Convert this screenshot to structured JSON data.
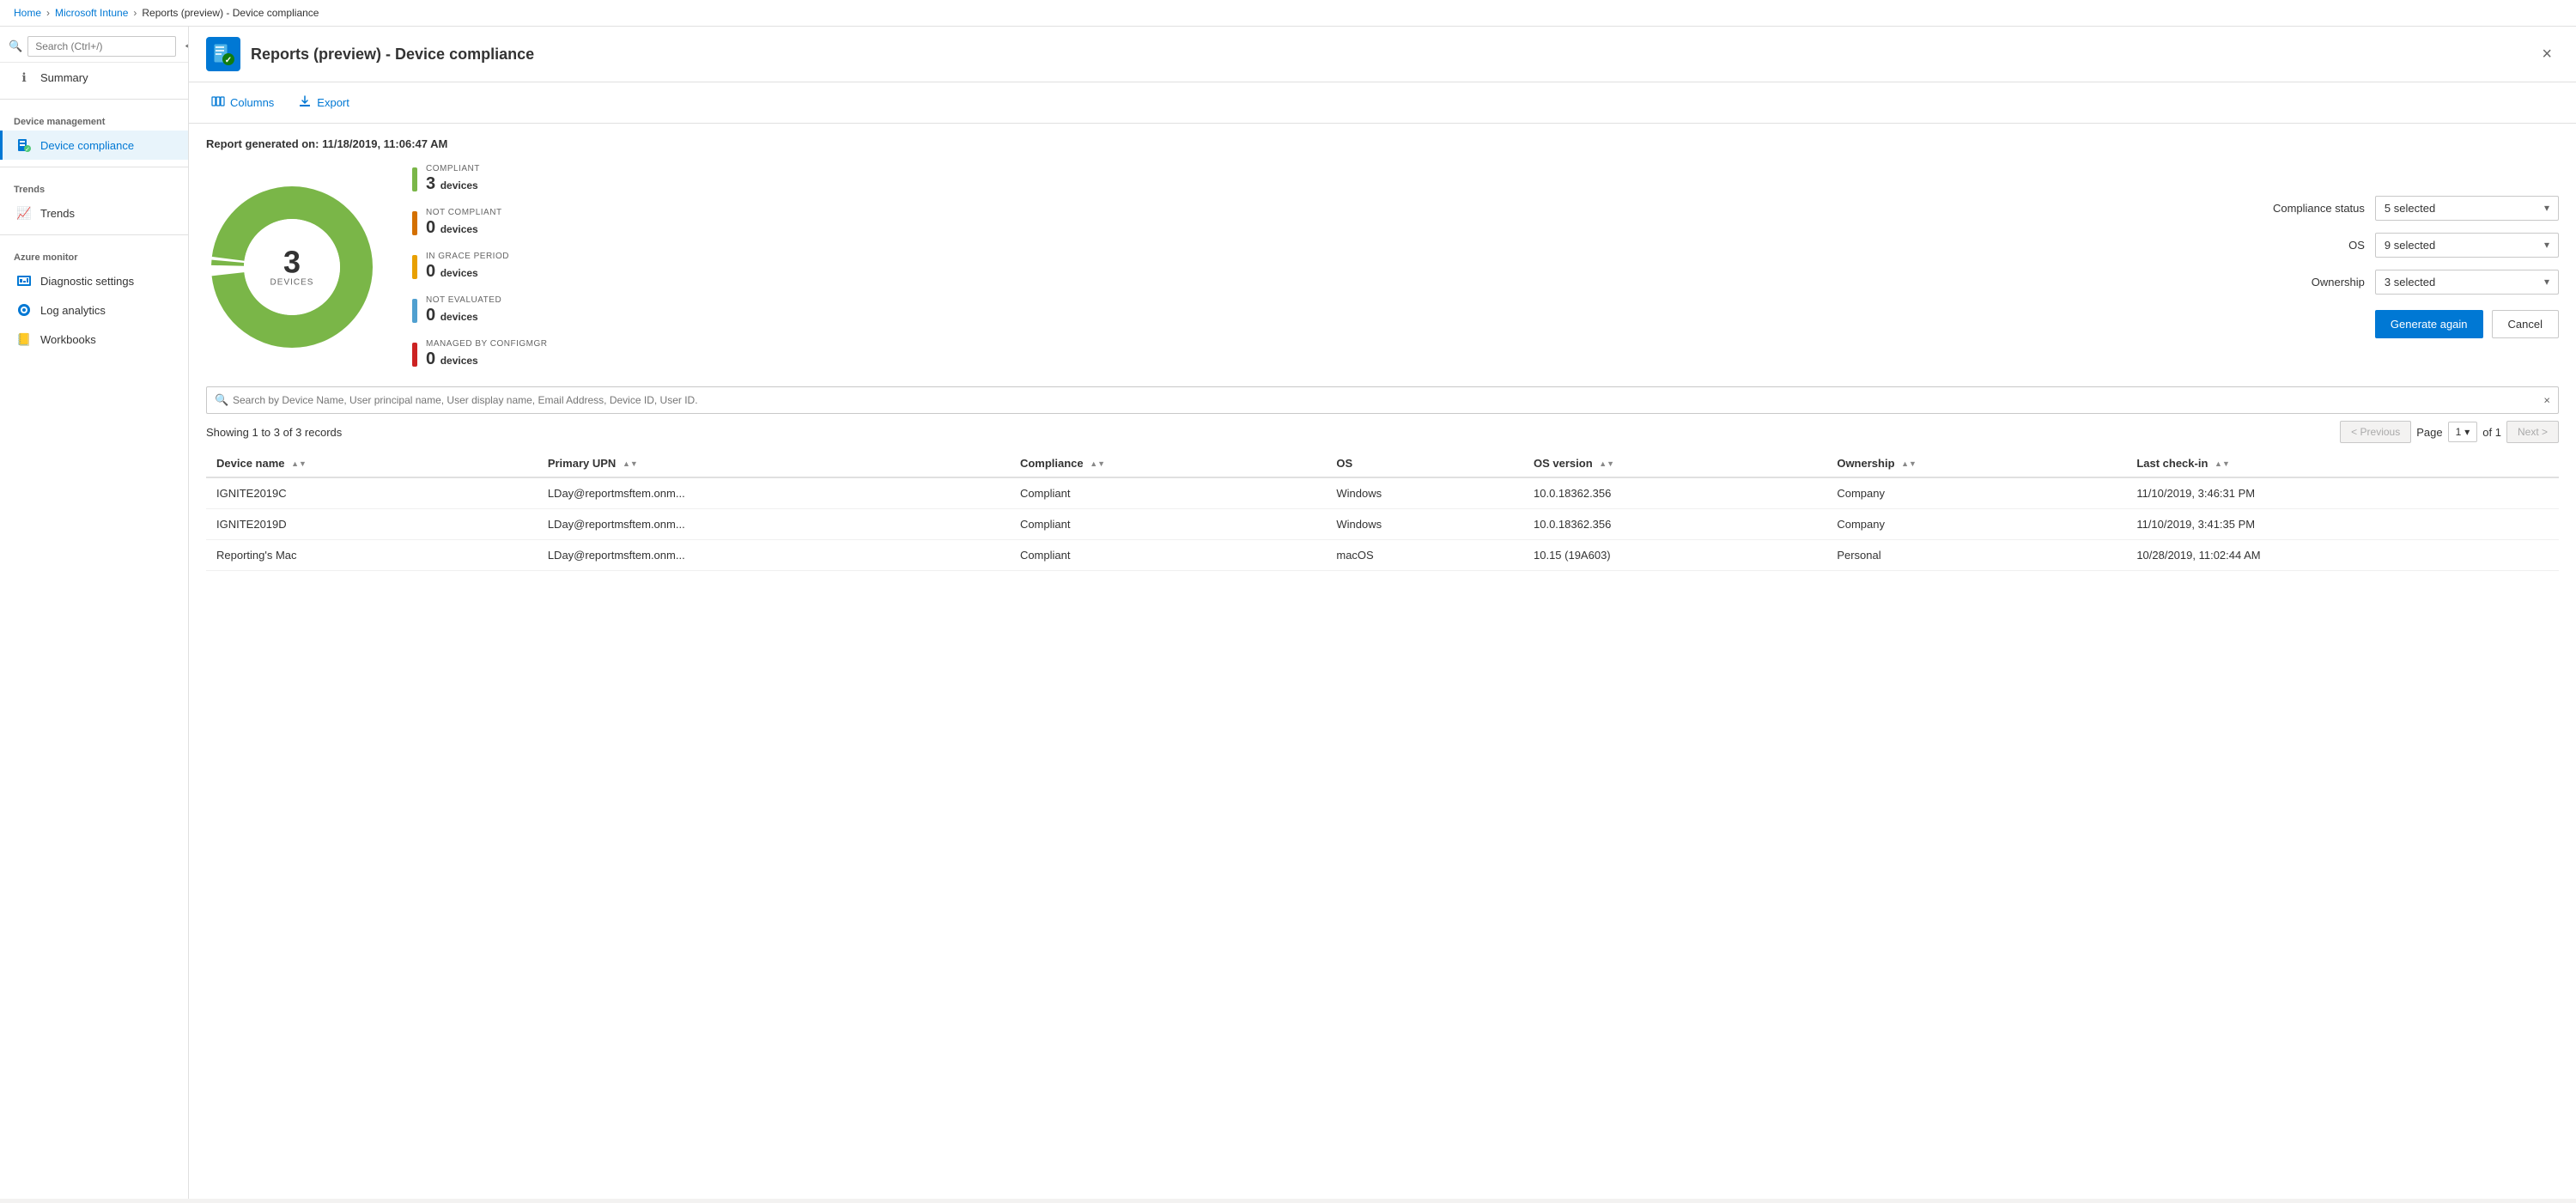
{
  "breadcrumb": {
    "items": [
      "Home",
      "Microsoft Intune",
      "Reports (preview) - Device compliance"
    ],
    "separators": [
      ">",
      ">"
    ]
  },
  "page": {
    "title": "Reports (preview) - Device compliance",
    "icon": "📊",
    "close_label": "×"
  },
  "sidebar": {
    "search_placeholder": "Search (Ctrl+/)",
    "collapse_icon": "≪",
    "items": [
      {
        "label": "Summary",
        "section": null,
        "active": false,
        "icon": "ℹ"
      },
      {
        "label": "Device management",
        "is_section": true
      },
      {
        "label": "Device compliance",
        "active": true,
        "icon": "📱"
      },
      {
        "label": "Trends",
        "is_section": true
      },
      {
        "label": "Trends",
        "active": false,
        "icon": "📈"
      },
      {
        "label": "Azure monitor",
        "is_section": true
      },
      {
        "label": "Diagnostic settings",
        "active": false,
        "icon": "🔧"
      },
      {
        "label": "Log analytics",
        "active": false,
        "icon": "📊"
      },
      {
        "label": "Workbooks",
        "active": false,
        "icon": "📒"
      }
    ]
  },
  "toolbar": {
    "columns_label": "Columns",
    "export_label": "Export"
  },
  "report": {
    "generated_label": "Report generated on:",
    "generated_date": "11/18/2019, 11:06:47 AM",
    "total_devices": "3",
    "total_label": "DEVICES",
    "chart": {
      "compliant_value": 3,
      "not_compliant_value": 0,
      "in_grace_value": 0,
      "not_evaluated_value": 0,
      "managed_configmgr_value": 0
    },
    "legend": [
      {
        "label": "COMPLIANT",
        "count": "3",
        "unit": "devices",
        "color": "#7ab648"
      },
      {
        "label": "NOT COMPLIANT",
        "count": "0",
        "unit": "devices",
        "color": "#d47000"
      },
      {
        "label": "IN GRACE PERIOD",
        "count": "0",
        "unit": "devices",
        "color": "#e8a000"
      },
      {
        "label": "NOT EVALUATED",
        "count": "0",
        "unit": "devices",
        "color": "#50a0d0"
      },
      {
        "label": "MANAGED BY CONFIGMGR",
        "count": "0",
        "unit": "devices",
        "color": "#cc2222"
      }
    ],
    "filters": {
      "compliance_status_label": "Compliance status",
      "compliance_status_value": "5 selected",
      "os_label": "OS",
      "os_value": "9 selected",
      "ownership_label": "Ownership",
      "ownership_value": "3 selected"
    },
    "generate_again_label": "Generate again",
    "cancel_label": "Cancel"
  },
  "search": {
    "placeholder": "Search by Device Name, User principal name, User display name, Email Address, Device ID, User ID."
  },
  "table": {
    "showing_text": "Showing 1 to 3 of 3 records",
    "pagination": {
      "previous_label": "< Previous",
      "page_label": "Page",
      "page_num": "1",
      "of_label": "of 1",
      "next_label": "Next >"
    },
    "columns": [
      {
        "label": "Device name",
        "sortable": true
      },
      {
        "label": "Primary UPN",
        "sortable": true
      },
      {
        "label": "Compliance",
        "sortable": true
      },
      {
        "label": "OS",
        "sortable": false
      },
      {
        "label": "OS version",
        "sortable": true
      },
      {
        "label": "Ownership",
        "sortable": true
      },
      {
        "label": "Last check-in",
        "sortable": true
      }
    ],
    "rows": [
      {
        "device_name": "IGNITE2019C",
        "primary_upn": "LDay@reportmsftem.onm...",
        "compliance": "Compliant",
        "os": "Windows",
        "os_version": "10.0.18362.356",
        "ownership": "Company",
        "last_checkin": "11/10/2019, 3:46:31 PM"
      },
      {
        "device_name": "IGNITE2019D",
        "primary_upn": "LDay@reportmsftem.onm...",
        "compliance": "Compliant",
        "os": "Windows",
        "os_version": "10.0.18362.356",
        "ownership": "Company",
        "last_checkin": "11/10/2019, 3:41:35 PM"
      },
      {
        "device_name": "Reporting's Mac",
        "primary_upn": "LDay@reportmsftem.onm...",
        "compliance": "Compliant",
        "os": "macOS",
        "os_version": "10.15 (19A603)",
        "ownership": "Personal",
        "last_checkin": "10/28/2019, 11:02:44 AM"
      }
    ]
  }
}
